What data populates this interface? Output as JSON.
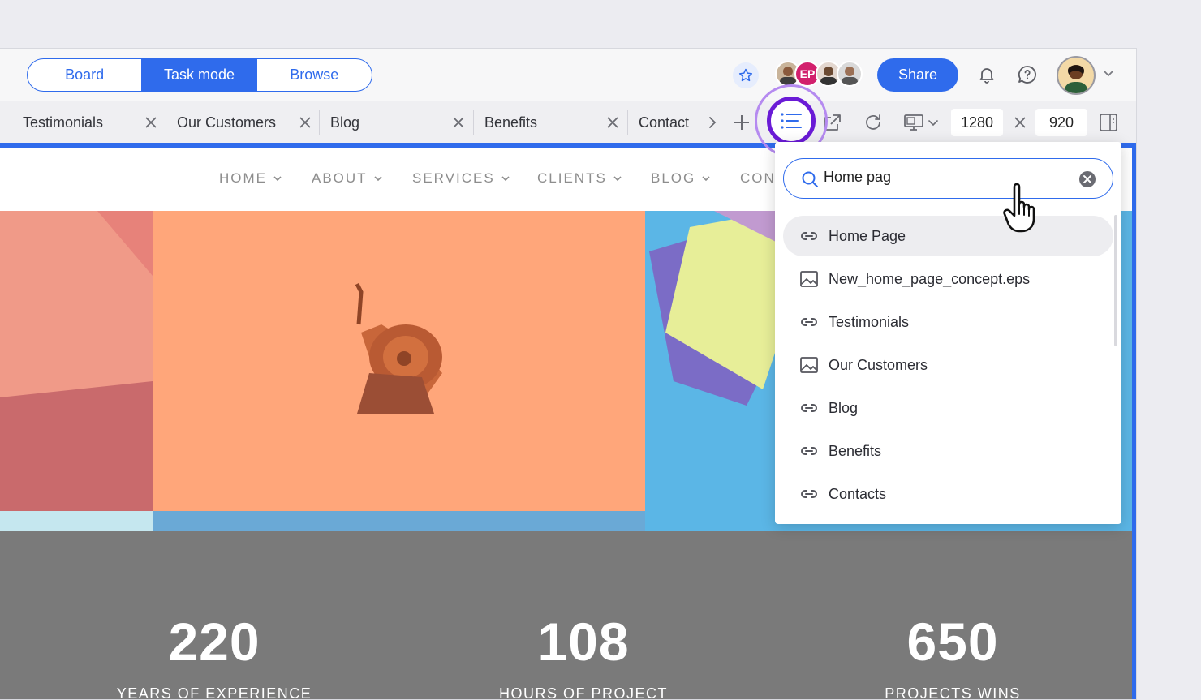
{
  "top_bar": {
    "modes": [
      "Board",
      "Task mode",
      "Browse"
    ],
    "active_mode": "Task mode",
    "avatar_initials": "EP",
    "share_label": "Share"
  },
  "tabs": [
    {
      "label": "Testimonials"
    },
    {
      "label": "Our Customers"
    },
    {
      "label": "Blog"
    },
    {
      "label": "Benefits"
    },
    {
      "label": "Contact"
    }
  ],
  "viewport_size": {
    "width": "1280",
    "height": "920"
  },
  "site": {
    "nav": [
      "HOME",
      "ABOUT",
      "SERVICES",
      "CLIENTS",
      "BLOG",
      "CON"
    ],
    "stats": [
      {
        "value": "220",
        "label": "YEARS OF EXPERIENCE"
      },
      {
        "value": "108",
        "label": "HOURS OF PROJECT"
      },
      {
        "value": "650",
        "label": "PROJECTS WINS"
      }
    ]
  },
  "search_popup": {
    "query": "Home pag",
    "results": [
      {
        "label": "Home Page",
        "icon": "link-icon"
      },
      {
        "label": "New_home_page_concept.eps",
        "icon": "image-icon"
      },
      {
        "label": "Testimonials",
        "icon": "link-icon"
      },
      {
        "label": "Our Customers",
        "icon": "image-icon"
      },
      {
        "label": "Blog",
        "icon": "link-icon"
      },
      {
        "label": "Benefits",
        "icon": "link-icon"
      },
      {
        "label": "Contacts",
        "icon": "link-icon"
      }
    ]
  },
  "colors": {
    "accent": "#2f6bec",
    "highlight_ring": "#6a1bd6",
    "hero_orange": "#ffa67a",
    "stats_bg": "#7a7a7a"
  }
}
